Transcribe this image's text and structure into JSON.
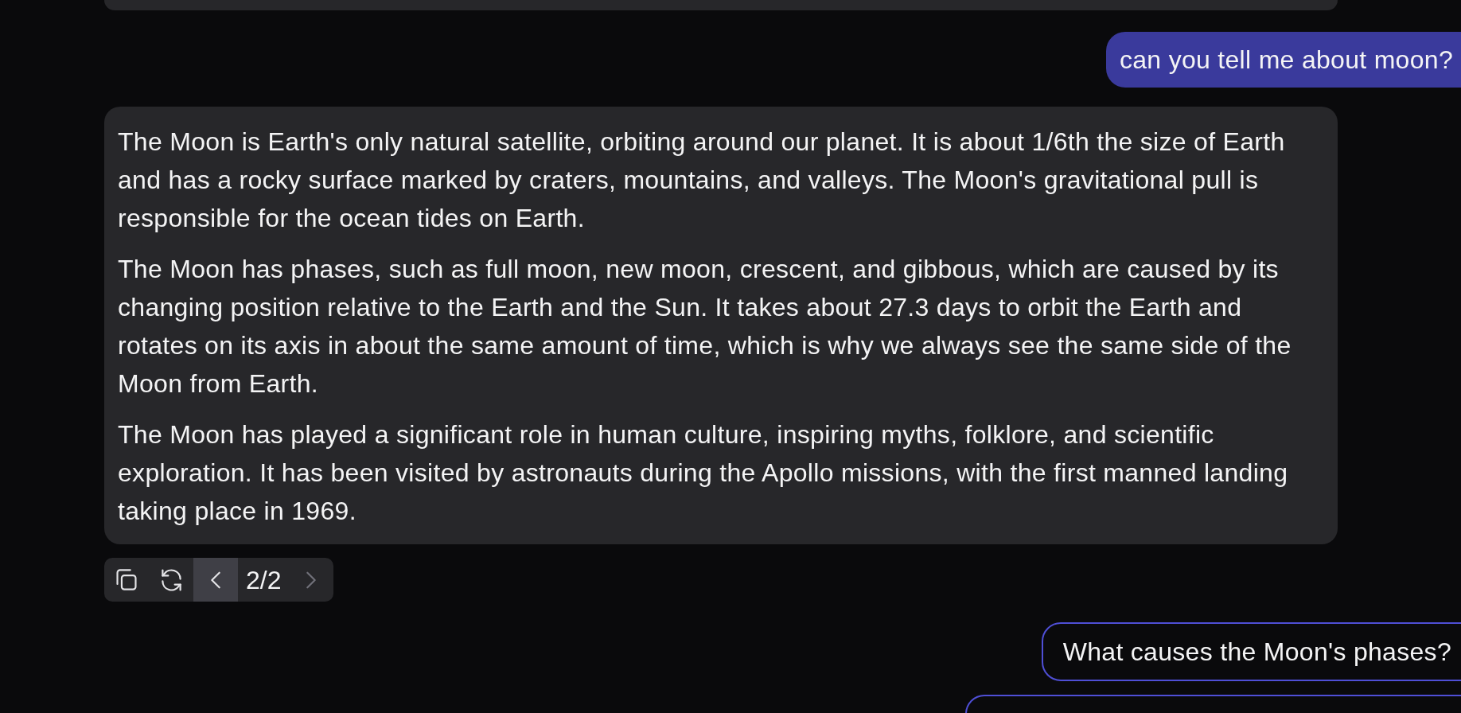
{
  "messages": [
    {
      "kind": "assistant-edge"
    },
    {
      "kind": "user",
      "text": "can you tell me about moon?"
    },
    {
      "kind": "assistant",
      "paragraphs": [
        "The Moon is Earth's only natural satellite, orbiting around our planet. It is about 1/6th the size of Earth and has a rocky surface marked by craters, mountains, and valleys. The Moon's gravitational pull is responsible for the ocean tides on Earth.",
        "The Moon has phases, such as full moon, new moon, crescent, and gibbous, which are caused by its changing position relative to the Earth and the Sun. It takes about 27.3 days to orbit the Earth and rotates on its axis in about the same amount of time, which is why we always see the same side of the Moon from Earth.",
        "The Moon has played a significant role in human culture, inspiring myths, folklore, and scientific exploration. It has been visited by astronauts during the Apollo missions, with the first manned landing taking place in 1969."
      ],
      "toolbar": [
        {
          "kind": "copy"
        },
        {
          "kind": "regenerate"
        },
        {
          "kind": "prev",
          "highlighted": true,
          "disabled": false
        },
        {
          "kind": "counter",
          "text": "2/2"
        },
        {
          "kind": "next",
          "highlighted": false,
          "disabled": true
        }
      ]
    },
    {
      "kind": "user-outline",
      "text": "What causes the Moon's phases?"
    },
    {
      "kind": "user-edge"
    }
  ]
}
